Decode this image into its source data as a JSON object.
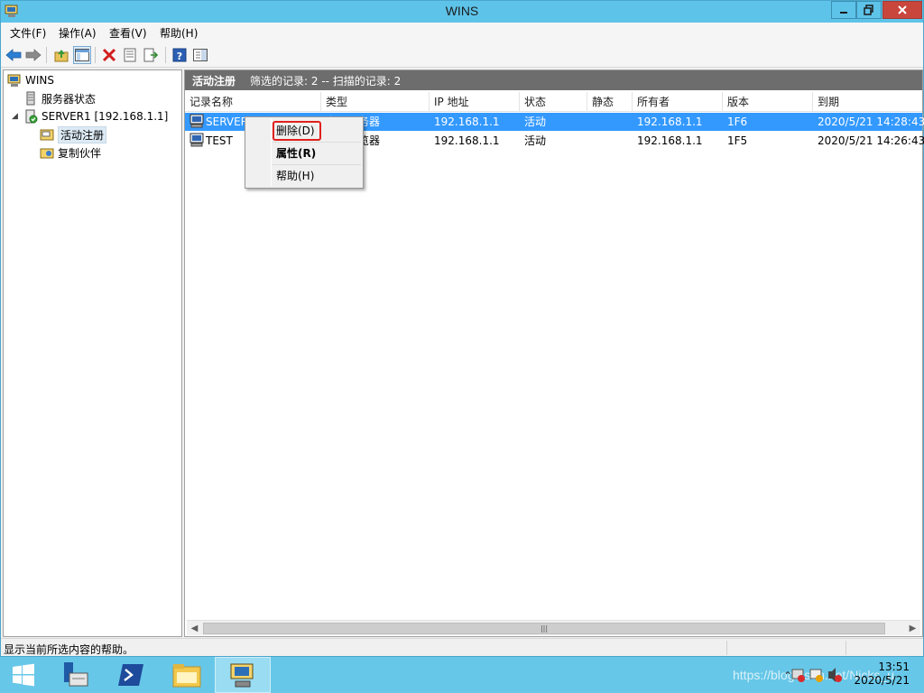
{
  "window": {
    "title": "WINS"
  },
  "menu": [
    "文件(F)",
    "操作(A)",
    "查看(V)",
    "帮助(H)"
  ],
  "toolbar": {
    "icons": [
      "back-arrow-icon",
      "forward-arrow-icon",
      "up-folder-icon",
      "show-hide-tree-icon",
      "delete-icon",
      "properties-icon",
      "export-list-icon",
      "help-icon",
      "console-icon"
    ]
  },
  "tree": {
    "root": "WINS",
    "server_status": "服务器状态",
    "server": "SERVER1 [192.168.1.1]",
    "active_registrations": "活动注册",
    "replication_partners": "复制伙伴"
  },
  "pane": {
    "title": "活动注册",
    "summary": "筛选的记录: 2 -- 扫描的记录: 2"
  },
  "columns": [
    "记录名称",
    "类型",
    "IP 地址",
    "状态",
    "静态",
    "所有者",
    "版本",
    "到期"
  ],
  "rows": [
    {
      "name": "SERVER",
      "type": "文件服务器",
      "ip": "192.168.1.1",
      "state": "活动",
      "static": "",
      "owner": "192.168.1.1",
      "version": "1F6",
      "expires": "2020/5/21 14:28:43"
    },
    {
      "name": "TEST",
      "type": "域主浏览器",
      "ip": "192.168.1.1",
      "state": "活动",
      "static": "",
      "owner": "192.168.1.1",
      "version": "1F5",
      "expires": "2020/5/21 14:26:43"
    }
  ],
  "context_menu": {
    "delete": "删除(D)",
    "properties": "属性(R)",
    "help": "帮助(H)"
  },
  "statusbar": {
    "text": "显示当前所选内容的帮助。"
  },
  "taskbar": {
    "clock_time": "13:51",
    "clock_date": "2020/5/21",
    "watermark": "https://blog.csdn.net/Nicks_u"
  },
  "colors": {
    "titlebar": "#5ec3e9",
    "selection": "#3399ff",
    "highlight_box": "#e0201b",
    "close_button": "#c9463d"
  }
}
